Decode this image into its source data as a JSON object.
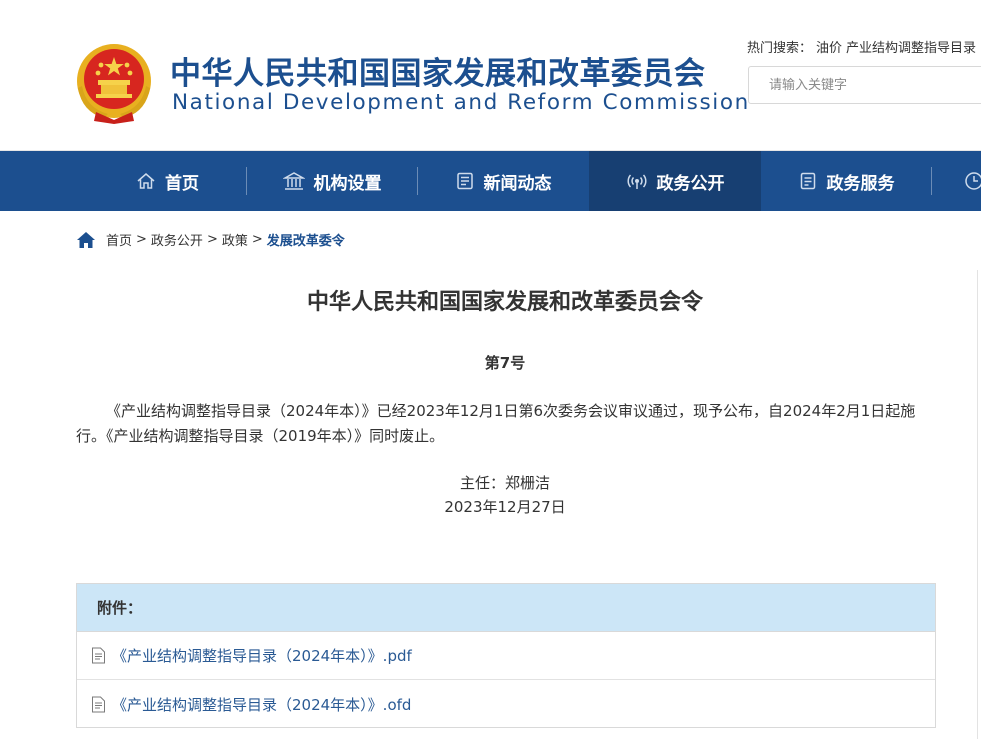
{
  "header": {
    "title_cn": "中华人民共和国国家发展和改革委员会",
    "title_en": "National Development and Reform Commission",
    "hot_search": {
      "label": "热门搜索：",
      "links": [
        "油价",
        "产业结构调整指导目录"
      ]
    },
    "search": {
      "placeholder": "请输入关键字"
    }
  },
  "nav": {
    "items": [
      {
        "label": "首页",
        "icon": "home-icon"
      },
      {
        "label": "机构设置",
        "icon": "building-icon"
      },
      {
        "label": "新闻动态",
        "icon": "newspaper-icon"
      },
      {
        "label": "政务公开",
        "icon": "broadcast-icon",
        "active": true
      },
      {
        "label": "政务服务",
        "icon": "document-icon"
      }
    ]
  },
  "breadcrumb": {
    "items": [
      "首页",
      "政务公开",
      "政策",
      "发展改革委令"
    ],
    "separator": ">"
  },
  "article": {
    "title": "中华人民共和国国家发展和改革委员会令",
    "number": "第7号",
    "body": "《产业结构调整指导目录（2024年本）》已经2023年12月1日第6次委务会议审议通过，现予公布，自2024年2月1日起施行。《产业结构调整指导目录（2019年本）》同时废止。",
    "signer": "主任：郑栅洁",
    "date": "2023年12月27日"
  },
  "attachments": {
    "label": "附件：",
    "files": [
      "《产业结构调整指导目录（2024年本）》.pdf",
      "《产业结构调整指导目录（2024年本）》.ofd"
    ]
  },
  "colors": {
    "brand_blue": "#1c4f8f",
    "nav_active": "#173f72",
    "attach_header": "#cce6f7",
    "emblem_red": "#d7261f",
    "emblem_gold": "#e8b020"
  }
}
